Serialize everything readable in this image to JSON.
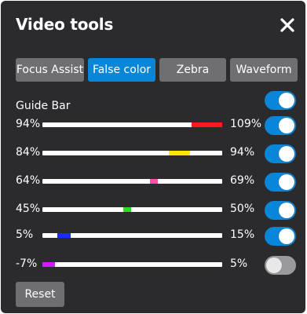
{
  "window": {
    "title": "Video tools",
    "close_icon": "close-icon"
  },
  "tabs": [
    {
      "label": "Focus Assist",
      "active": false
    },
    {
      "label": "False color",
      "active": true
    },
    {
      "label": "Zebra",
      "active": false
    },
    {
      "label": "Waveform",
      "active": false
    }
  ],
  "guide_bar": {
    "label": "Guide Bar",
    "enabled": true
  },
  "ranges": [
    {
      "low": "94%",
      "high": "109%",
      "color": "#ff1a1a",
      "enabled": true
    },
    {
      "low": "84%",
      "high": "94%",
      "color": "#ffe600",
      "enabled": true
    },
    {
      "low": "64%",
      "high": "69%",
      "color": "#ff4fa8",
      "enabled": true
    },
    {
      "low": "45%",
      "high": "50%",
      "color": "#22e02a",
      "enabled": true
    },
    {
      "low": "5%",
      "high": "15%",
      "color": "#1a2cff",
      "enabled": true
    },
    {
      "low": "-7%",
      "high": "5%",
      "color": "#d21aff",
      "enabled": false
    }
  ],
  "reset_label": "Reset",
  "colors": {
    "accent": "#0a86d8",
    "panel": "#2b2b2e",
    "button": "#6f6f72"
  }
}
